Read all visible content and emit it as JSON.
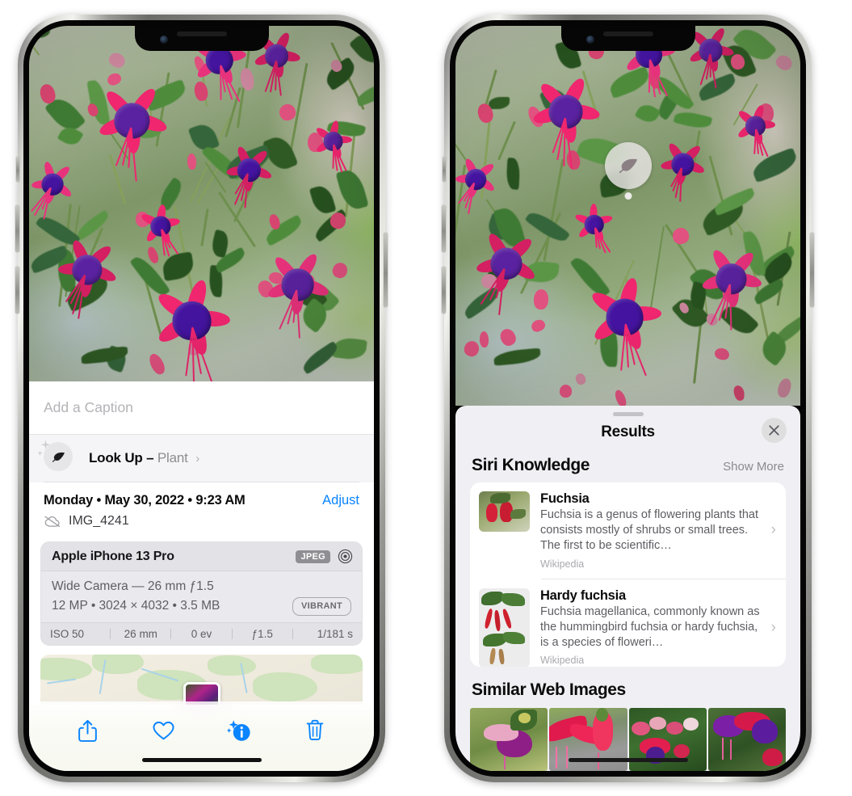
{
  "left_phone": {
    "caption": {
      "placeholder": "Add a Caption",
      "value": ""
    },
    "lookup": {
      "label": "Look Up –",
      "subject": "Plant",
      "chevron": "›",
      "icon": "leaf-icon"
    },
    "meta": {
      "date_line": "Monday • May 30, 2022 • 9:23 AM",
      "adjust_label": "Adjust",
      "filename": "IMG_4241",
      "cloud_icon": "cloud-slash-icon"
    },
    "camera": {
      "model": "Apple iPhone 13 Pro",
      "format_tag": "JPEG",
      "aperture_icon": "aperture-icon",
      "lens_line": "Wide Camera — 26 mm ƒ1.5",
      "specs_line": "12 MP • 3024 × 4032 • 3.5 MB",
      "style_tag": "VIBRANT",
      "exif": [
        {
          "label": "ISO 50"
        },
        {
          "label": "26 mm"
        },
        {
          "label": "0 ev"
        },
        {
          "label": "ƒ1.5"
        },
        {
          "label": "1/181 s"
        }
      ]
    },
    "toolbar": [
      {
        "name": "share-button",
        "icon": "share-icon"
      },
      {
        "name": "favorite-button",
        "icon": "heart-icon"
      },
      {
        "name": "info-button",
        "icon": "info-sparkle-icon"
      },
      {
        "name": "delete-button",
        "icon": "trash-icon"
      }
    ],
    "accent": "#0a84ff"
  },
  "right_phone": {
    "lookup_badge": {
      "icon": "leaf-icon"
    },
    "sheet": {
      "title": "Results",
      "close_icon": "close-icon",
      "sections": [
        {
          "title": "Siri Knowledge",
          "action_label": "Show More",
          "items": [
            {
              "title": "Fuchsia",
              "description": "Fuchsia is a genus of flowering plants that consists mostly of shrubs or small trees. The first to be scientific…",
              "source": "Wikipedia",
              "chevron": "›"
            },
            {
              "title": "Hardy fuchsia",
              "description": "Fuchsia magellanica, commonly known as the hummingbird fuchsia or hardy fuchsia, is a species of floweri…",
              "source": "Wikipedia",
              "chevron": "›"
            }
          ]
        },
        {
          "title": "Similar Web Images",
          "items": [
            {
              "name": "web-image-1"
            },
            {
              "name": "web-image-2"
            },
            {
              "name": "web-image-3"
            },
            {
              "name": "web-image-4"
            }
          ]
        }
      ]
    }
  },
  "colors": {
    "accent_blue": "#0a84ff",
    "sheet_bg": "#f0f0f4",
    "card_bg": "#ffffff",
    "flower_pink": "#e8327c",
    "flower_purple": "#5a22a0",
    "leaf_green": "#3f7a34"
  }
}
